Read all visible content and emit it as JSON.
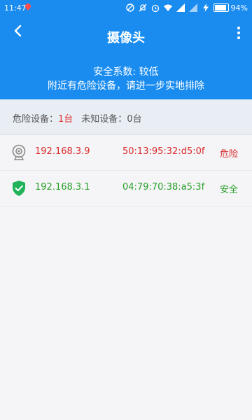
{
  "statusbar": {
    "time": "11:47",
    "battery": "94%"
  },
  "header": {
    "title": "摄像头",
    "safety_score": "安全系数: 较低",
    "advice": "附近有危险设备，请进一步实地排除"
  },
  "summary": {
    "danger_label": "危险设备：",
    "danger_count": "1台",
    "unknown_label": "未知设备：",
    "unknown_count": "0台"
  },
  "devices": [
    {
      "ip": "192.168.3.9",
      "mac": "50:13:95:32:d5:0f",
      "status": "危险",
      "icon": "camera-icon"
    },
    {
      "ip": "192.168.3.1",
      "mac": "04:79:70:38:a5:3f",
      "status": "安全",
      "icon": "shield-check-icon"
    }
  ],
  "colors": {
    "header_bg": "#1a8cf0",
    "danger": "#d92a2a",
    "safe": "#2aa02a"
  }
}
